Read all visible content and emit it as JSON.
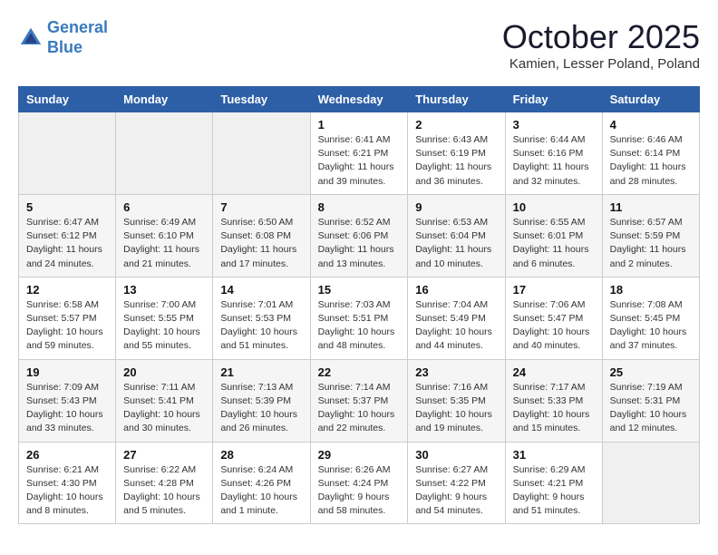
{
  "header": {
    "logo_line1": "General",
    "logo_line2": "Blue",
    "month_title": "October 2025",
    "subtitle": "Kamien, Lesser Poland, Poland"
  },
  "weekdays": [
    "Sunday",
    "Monday",
    "Tuesday",
    "Wednesday",
    "Thursday",
    "Friday",
    "Saturday"
  ],
  "weeks": [
    [
      {
        "day": "",
        "info": ""
      },
      {
        "day": "",
        "info": ""
      },
      {
        "day": "",
        "info": ""
      },
      {
        "day": "1",
        "info": "Sunrise: 6:41 AM\nSunset: 6:21 PM\nDaylight: 11 hours\nand 39 minutes."
      },
      {
        "day": "2",
        "info": "Sunrise: 6:43 AM\nSunset: 6:19 PM\nDaylight: 11 hours\nand 36 minutes."
      },
      {
        "day": "3",
        "info": "Sunrise: 6:44 AM\nSunset: 6:16 PM\nDaylight: 11 hours\nand 32 minutes."
      },
      {
        "day": "4",
        "info": "Sunrise: 6:46 AM\nSunset: 6:14 PM\nDaylight: 11 hours\nand 28 minutes."
      }
    ],
    [
      {
        "day": "5",
        "info": "Sunrise: 6:47 AM\nSunset: 6:12 PM\nDaylight: 11 hours\nand 24 minutes."
      },
      {
        "day": "6",
        "info": "Sunrise: 6:49 AM\nSunset: 6:10 PM\nDaylight: 11 hours\nand 21 minutes."
      },
      {
        "day": "7",
        "info": "Sunrise: 6:50 AM\nSunset: 6:08 PM\nDaylight: 11 hours\nand 17 minutes."
      },
      {
        "day": "8",
        "info": "Sunrise: 6:52 AM\nSunset: 6:06 PM\nDaylight: 11 hours\nand 13 minutes."
      },
      {
        "day": "9",
        "info": "Sunrise: 6:53 AM\nSunset: 6:04 PM\nDaylight: 11 hours\nand 10 minutes."
      },
      {
        "day": "10",
        "info": "Sunrise: 6:55 AM\nSunset: 6:01 PM\nDaylight: 11 hours\nand 6 minutes."
      },
      {
        "day": "11",
        "info": "Sunrise: 6:57 AM\nSunset: 5:59 PM\nDaylight: 11 hours\nand 2 minutes."
      }
    ],
    [
      {
        "day": "12",
        "info": "Sunrise: 6:58 AM\nSunset: 5:57 PM\nDaylight: 10 hours\nand 59 minutes."
      },
      {
        "day": "13",
        "info": "Sunrise: 7:00 AM\nSunset: 5:55 PM\nDaylight: 10 hours\nand 55 minutes."
      },
      {
        "day": "14",
        "info": "Sunrise: 7:01 AM\nSunset: 5:53 PM\nDaylight: 10 hours\nand 51 minutes."
      },
      {
        "day": "15",
        "info": "Sunrise: 7:03 AM\nSunset: 5:51 PM\nDaylight: 10 hours\nand 48 minutes."
      },
      {
        "day": "16",
        "info": "Sunrise: 7:04 AM\nSunset: 5:49 PM\nDaylight: 10 hours\nand 44 minutes."
      },
      {
        "day": "17",
        "info": "Sunrise: 7:06 AM\nSunset: 5:47 PM\nDaylight: 10 hours\nand 40 minutes."
      },
      {
        "day": "18",
        "info": "Sunrise: 7:08 AM\nSunset: 5:45 PM\nDaylight: 10 hours\nand 37 minutes."
      }
    ],
    [
      {
        "day": "19",
        "info": "Sunrise: 7:09 AM\nSunset: 5:43 PM\nDaylight: 10 hours\nand 33 minutes."
      },
      {
        "day": "20",
        "info": "Sunrise: 7:11 AM\nSunset: 5:41 PM\nDaylight: 10 hours\nand 30 minutes."
      },
      {
        "day": "21",
        "info": "Sunrise: 7:13 AM\nSunset: 5:39 PM\nDaylight: 10 hours\nand 26 minutes."
      },
      {
        "day": "22",
        "info": "Sunrise: 7:14 AM\nSunset: 5:37 PM\nDaylight: 10 hours\nand 22 minutes."
      },
      {
        "day": "23",
        "info": "Sunrise: 7:16 AM\nSunset: 5:35 PM\nDaylight: 10 hours\nand 19 minutes."
      },
      {
        "day": "24",
        "info": "Sunrise: 7:17 AM\nSunset: 5:33 PM\nDaylight: 10 hours\nand 15 minutes."
      },
      {
        "day": "25",
        "info": "Sunrise: 7:19 AM\nSunset: 5:31 PM\nDaylight: 10 hours\nand 12 minutes."
      }
    ],
    [
      {
        "day": "26",
        "info": "Sunrise: 6:21 AM\nSunset: 4:30 PM\nDaylight: 10 hours\nand 8 minutes."
      },
      {
        "day": "27",
        "info": "Sunrise: 6:22 AM\nSunset: 4:28 PM\nDaylight: 10 hours\nand 5 minutes."
      },
      {
        "day": "28",
        "info": "Sunrise: 6:24 AM\nSunset: 4:26 PM\nDaylight: 10 hours\nand 1 minute."
      },
      {
        "day": "29",
        "info": "Sunrise: 6:26 AM\nSunset: 4:24 PM\nDaylight: 9 hours\nand 58 minutes."
      },
      {
        "day": "30",
        "info": "Sunrise: 6:27 AM\nSunset: 4:22 PM\nDaylight: 9 hours\nand 54 minutes."
      },
      {
        "day": "31",
        "info": "Sunrise: 6:29 AM\nSunset: 4:21 PM\nDaylight: 9 hours\nand 51 minutes."
      },
      {
        "day": "",
        "info": ""
      }
    ]
  ]
}
